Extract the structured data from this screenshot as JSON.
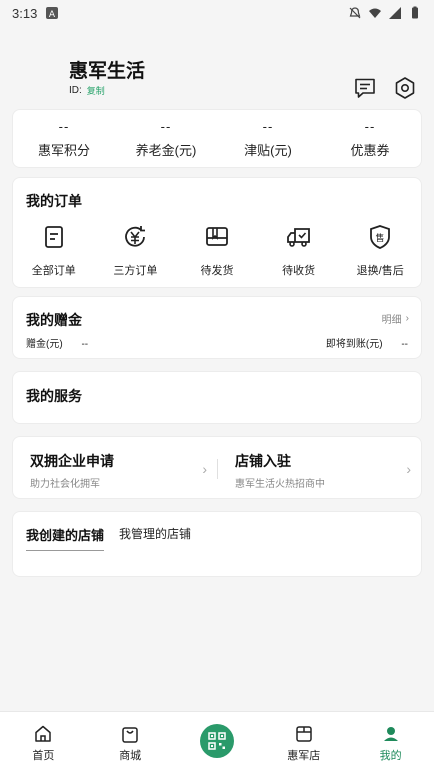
{
  "status_bar": {
    "time": "3:13"
  },
  "header": {
    "title": "惠军生活",
    "id_label": "ID:",
    "copy_label": "复制"
  },
  "stats": [
    {
      "value": "--",
      "label": "惠军积分"
    },
    {
      "value": "--",
      "label": "养老金(元)"
    },
    {
      "value": "--",
      "label": "津贴(元)"
    },
    {
      "value": "--",
      "label": "优惠券"
    }
  ],
  "orders": {
    "title": "我的订单",
    "items": [
      {
        "label": "全部订单",
        "icon": "document-icon"
      },
      {
        "label": "三方订单",
        "icon": "yuan-refresh-icon"
      },
      {
        "label": "待发货",
        "icon": "box-icon"
      },
      {
        "label": "待收货",
        "icon": "truck-icon"
      },
      {
        "label": "退换/售后",
        "icon": "shield-sale-icon"
      }
    ]
  },
  "gift": {
    "title": "我的赠金",
    "detail": "明细",
    "balance_label": "赠金(元)",
    "balance_value": "--",
    "pending_label": "即将到账(元)",
    "pending_value": "--"
  },
  "services": {
    "title": "我的服务"
  },
  "apply": [
    {
      "title": "双拥企业申请",
      "subtitle": "助力社会化拥军"
    },
    {
      "title": "店铺入驻",
      "subtitle": "惠军生活火热招商中"
    }
  ],
  "shops": {
    "tabs": [
      "我创建的店铺",
      "我管理的店铺"
    ]
  },
  "tabbar": {
    "items": [
      {
        "label": "首页",
        "icon": "home-icon"
      },
      {
        "label": "商城",
        "icon": "shopping-bag-icon"
      },
      {
        "label": "",
        "icon": "qr-code-icon"
      },
      {
        "label": "惠军店",
        "icon": "store-icon"
      },
      {
        "label": "我的",
        "icon": "user-icon"
      }
    ],
    "active_color": "#1f8a5b"
  },
  "colors": {
    "accent": "#2a9a6a",
    "background": "#f5f5f5"
  }
}
